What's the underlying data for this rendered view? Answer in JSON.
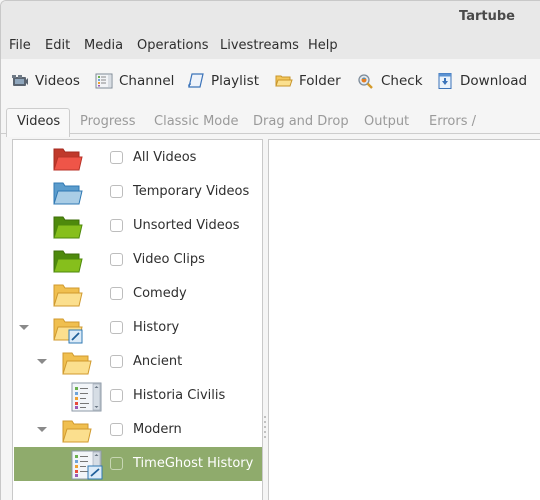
{
  "window": {
    "title": "Tartube"
  },
  "menubar": {
    "items": [
      {
        "label": "File"
      },
      {
        "label": "Edit"
      },
      {
        "label": "Media"
      },
      {
        "label": "Operations"
      },
      {
        "label": "Livestreams"
      },
      {
        "label": "Help"
      }
    ]
  },
  "toolbar": {
    "buttons": [
      {
        "label": "Videos",
        "icon": "video-camera-icon"
      },
      {
        "label": "Channel",
        "icon": "channel-list-icon"
      },
      {
        "label": "Playlist",
        "icon": "playlist-scroll-icon"
      },
      {
        "label": "Folder",
        "icon": "folder-icon"
      },
      {
        "label": "Check",
        "icon": "check-magnifier-icon"
      },
      {
        "label": "Download",
        "icon": "download-icon"
      }
    ]
  },
  "tabs": [
    {
      "label": "Videos",
      "active": true
    },
    {
      "label": "Progress",
      "active": false
    },
    {
      "label": "Classic Mode",
      "active": false
    },
    {
      "label": "Drag and Drop",
      "active": false
    },
    {
      "label": "Output",
      "active": false
    },
    {
      "label": "Errors / Warnings",
      "active": false
    }
  ],
  "tree": {
    "items": [
      {
        "label": "All Videos",
        "icon": "red-folder-icon",
        "color": "#e8473c",
        "level": 0,
        "expander": false,
        "checked": false,
        "selected": false
      },
      {
        "label": "Temporary Videos",
        "icon": "blue-folder-icon",
        "color": "#7fb3d8",
        "level": 0,
        "expander": false,
        "checked": false,
        "selected": false
      },
      {
        "label": "Unsorted Videos",
        "icon": "green-folder-icon",
        "color": "#7cb518",
        "level": 0,
        "expander": false,
        "checked": false,
        "selected": false
      },
      {
        "label": "Video Clips",
        "icon": "green-folder-icon",
        "color": "#7cb518",
        "level": 0,
        "expander": false,
        "checked": false,
        "selected": false
      },
      {
        "label": "Comedy",
        "icon": "yellow-folder-icon",
        "color": "#f7d26b",
        "level": 0,
        "expander": false,
        "checked": false,
        "selected": false
      },
      {
        "label": "History",
        "icon": "yellow-folder-edit-icon",
        "color": "#f7d26b",
        "level": 0,
        "expander": true,
        "checked": false,
        "selected": false
      },
      {
        "label": "Ancient",
        "icon": "yellow-folder-icon",
        "color": "#f7d26b",
        "level": 1,
        "expander": true,
        "checked": false,
        "selected": false
      },
      {
        "label": "Historia Civilis",
        "icon": "channel-icon",
        "color": "#dfe8f2",
        "level": 2,
        "expander": false,
        "checked": false,
        "selected": false
      },
      {
        "label": "Modern",
        "icon": "yellow-folder-icon",
        "color": "#f7d26b",
        "level": 1,
        "expander": true,
        "checked": false,
        "selected": false
      },
      {
        "label": "TimeGhost History",
        "icon": "channel-edit-icon",
        "color": "#dfe8f2",
        "level": 2,
        "expander": false,
        "checked": false,
        "selected": true
      }
    ]
  },
  "colors": {
    "selection": "#8fab6c",
    "titlebar": "#e8e8e8"
  }
}
